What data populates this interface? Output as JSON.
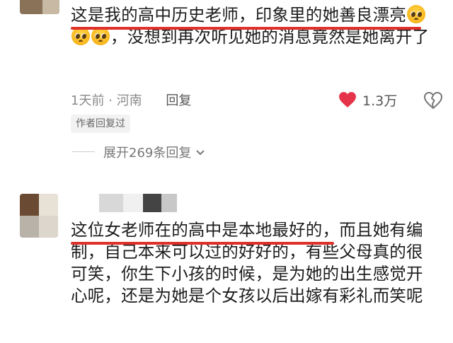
{
  "comments": [
    {
      "text_parts": [
        "这是我的高中历史老师，印象里的她善良漂亮",
        "，没想到再次听见她的消息竟然是她离开了"
      ],
      "meta_time": "1天前",
      "meta_loc": "河南",
      "reply_label": "回复",
      "like_count": "1.3万",
      "author_badge": "作者回复过",
      "expand_label": "展开269条回复"
    },
    {
      "text": "这位女老师在的高中是本地最好的，而且她有编制，自己本来可以过的好好的，有些父母真的很可笑，你生下小孩的时候，是为她的出生感觉开心呢，还是为她是个女孩以后出嫁有彩礼而笑呢"
    }
  ],
  "colors": {
    "underline": "#e0302a",
    "like_heart": "#e5334a"
  },
  "icons": {
    "emoji": "pleading-face-icon",
    "like": "heart-icon",
    "dislike": "broken-heart-icon",
    "expand": "chevron-down-icon"
  }
}
